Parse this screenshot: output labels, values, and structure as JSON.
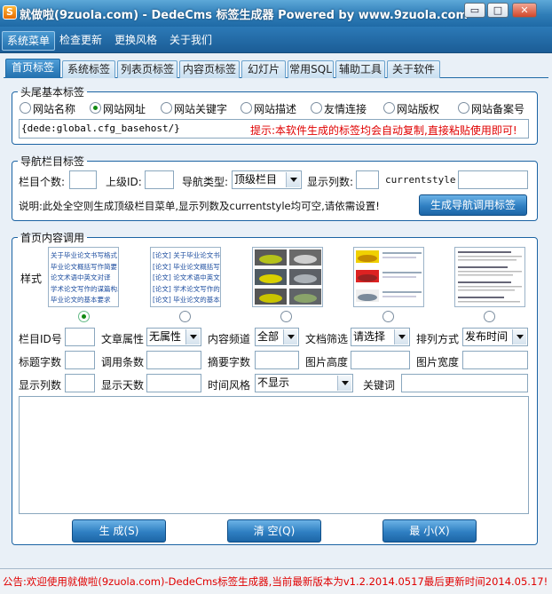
{
  "window": {
    "icon_letter": "S",
    "title": "就做啦(9zuola.com) - DedeCms 标签生成器 Powered by www.9zuola.com",
    "btn_min": "▭",
    "btn_max": "□",
    "btn_close": "✕"
  },
  "menu": [
    "系统菜单",
    "检查更新",
    "更换风格",
    "关于我们"
  ],
  "tabs": [
    "首页标签",
    "系统标签",
    "列表页标签",
    "内容页标签",
    "幻灯片",
    "常用SQL",
    "辅助工具",
    "关于软件"
  ],
  "header_tags": {
    "legend": "头尾基本标签",
    "options": [
      "网站名称",
      "网站网址",
      "网站关键字",
      "网站描述",
      "友情连接",
      "网站版权",
      "网站备案号"
    ],
    "selected_index": 1,
    "code": "{dede:global.cfg_basehost/}",
    "hint": "提示:本软件生成的标签均会自动复制,直接粘贴使用即可!"
  },
  "nav_tags": {
    "legend": "导航栏目标签",
    "count_label": "栏目个数:",
    "count_value": "",
    "parent_label": "上级ID:",
    "parent_value": "",
    "type_label": "导航类型:",
    "type_value": "顶级栏目",
    "cols_label": "显示列数:",
    "cols_value": "",
    "style_label": "currentstyle:",
    "style_value": "",
    "note": "说明:此处全空则生成顶级栏目菜单,显示列数及currentstyle均可空,请依需设置!",
    "generate_btn": "生成导航调用标签"
  },
  "home_content": {
    "legend": "首页内容调用",
    "style_label": "样式",
    "selected_style": 0,
    "thumb1_lines": [
      "关于毕业论文书写格式",
      "毕业论文概括写作简要",
      "论文术语中英文对译",
      "学术论文写作的谋篇构思",
      "毕业论文的基本要求"
    ],
    "thumb2_lines": [
      "[论文] 关于毕业论文书写",
      "[论文] 毕业论文概括写作",
      "[论文] 论文术语中英文对",
      "[论文] 学术论文写作的谋",
      "[论文] 毕业论文的基本要"
    ],
    "fields": {
      "catid_label": "栏目ID号",
      "catid_value": "",
      "attr_label": "文章属性",
      "attr_value": "无属性",
      "channel_label": "内容频道",
      "channel_value": "全部",
      "filter_label": "文档筛选",
      "filter_value": "请选择",
      "order_label": "排列方式",
      "order_value": "发布时间",
      "title_len_label": "标题字数",
      "title_len_value": "",
      "row_label": "调用条数",
      "row_value": "",
      "info_len_label": "摘要字数",
      "info_len_value": "",
      "img_h_label": "图片高度",
      "img_h_value": "",
      "img_w_label": "图片宽度",
      "img_w_value": "",
      "col_label": "显示列数",
      "col_value": "",
      "days_label": "显示天数",
      "days_value": "",
      "time_style_label": "时间风格",
      "time_style_value": "不显示",
      "keyword_label": "关键词",
      "keyword_value": ""
    },
    "output": ""
  },
  "actions": {
    "generate": "生 成(S)",
    "clear": "清 空(Q)",
    "minimize": "最 小(X)"
  },
  "status": "公告:欢迎使用就做啦(9zuola.com)-DedeCms标签生成器,当前最新版本为v1.2.2014.0517最后更新时间2014.05.17!",
  "colors": {
    "accent": "#1f6aa6",
    "hint": "#e00000",
    "selected_radio": "#118a11"
  }
}
